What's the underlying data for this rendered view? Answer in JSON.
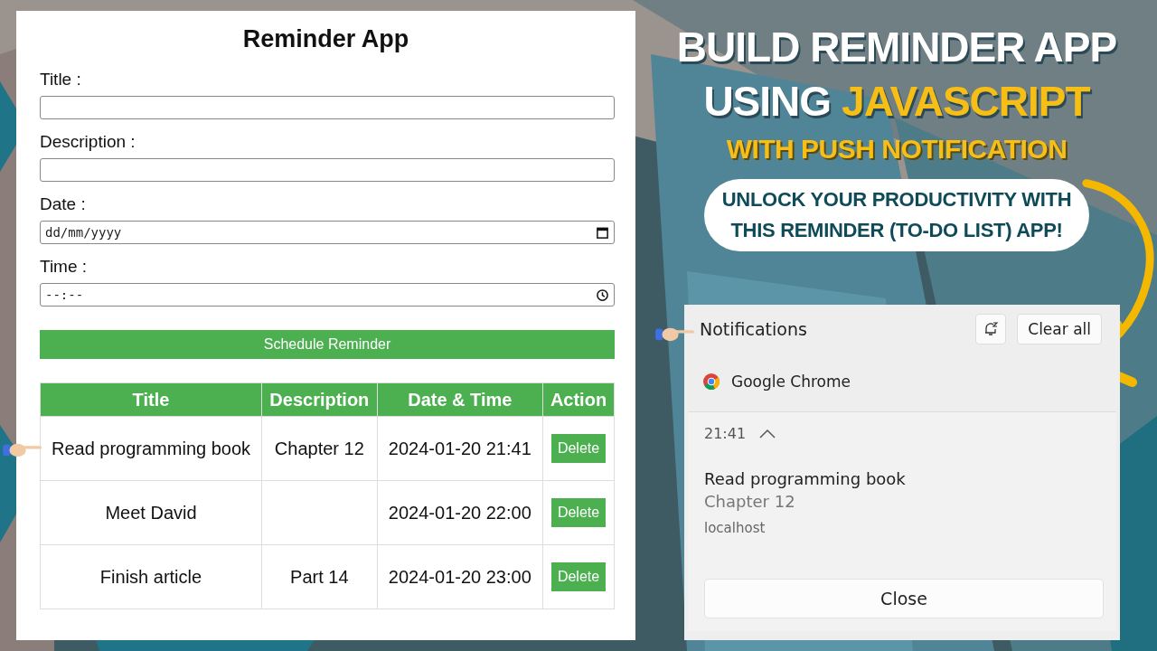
{
  "app": {
    "title": "Reminder App",
    "fields": [
      {
        "label": "Title :",
        "kind": "text"
      },
      {
        "label": "Description :",
        "kind": "text"
      },
      {
        "label": "Date :",
        "kind": "date",
        "placeholder": "dd/mm/yyyy"
      },
      {
        "label": "Time :",
        "kind": "time",
        "placeholder": "--:--"
      }
    ],
    "submit_button": "Schedule Reminder",
    "table": {
      "columns": [
        "Title",
        "Description",
        "Date & Time",
        "Action"
      ],
      "rows": [
        {
          "title": "Read programming book",
          "description": "Chapter 12",
          "date_time": "2024-01-20 21:41",
          "action": "Delete",
          "pointed": true
        },
        {
          "title": "Meet David",
          "description": "",
          "date_time": "2024-01-20 22:00",
          "action": "Delete",
          "pointed": false
        },
        {
          "title": "Finish article",
          "description": "Part 14",
          "date_time": "2024-01-20 23:00",
          "action": "Delete",
          "pointed": false
        }
      ]
    }
  },
  "headline": {
    "line_1": "BUILD REMINDER APP",
    "line_2_start": "USING",
    "line_2_highlight": "JAVASCRIPT",
    "subtitle": "WITH PUSH NOTIFICATION",
    "tagline": [
      "UNLOCK YOUR PRODUCTIVITY WITH",
      "THIS REMINDER (TO-DO LIST) APP!"
    ]
  },
  "notifications": {
    "title": "Notifications",
    "clear_button": "Clear all",
    "app_name": "Google Chrome",
    "time": "21:41",
    "expanded": true,
    "message_title": "Read programming book",
    "message_body": "Chapter 12",
    "source": "localhost",
    "close_button": "Close"
  }
}
